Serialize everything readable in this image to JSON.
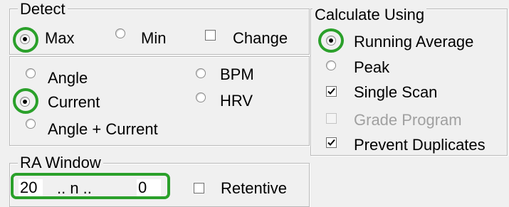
{
  "detect": {
    "legend": "Detect",
    "options": {
      "max": {
        "label": "Max",
        "selected": true
      },
      "min": {
        "label": "Min",
        "selected": false
      },
      "change": {
        "label": "Change",
        "checked": false
      }
    }
  },
  "signal": {
    "angle": "Angle",
    "bpm": "BPM",
    "current": "Current",
    "hrv": "HRV",
    "angle_current": "Angle + Current",
    "selected": "current"
  },
  "calculate": {
    "legend": "Calculate Using",
    "running_average": {
      "label": "Running Average",
      "selected": true
    },
    "peak": {
      "label": "Peak",
      "selected": false
    },
    "single_scan": {
      "label": "Single Scan",
      "checked": true
    },
    "grade_program": {
      "label": "Grade Program",
      "checked": false,
      "disabled": true
    },
    "prevent_duplicates": {
      "label": "Prevent Duplicates",
      "checked": true
    }
  },
  "ra_window": {
    "legend": "RA Window",
    "start": "20",
    "separator": ".. n ..",
    "end": "0",
    "retentive": {
      "label": "Retentive",
      "checked": false
    }
  },
  "highlight_color": "#2aa02a"
}
